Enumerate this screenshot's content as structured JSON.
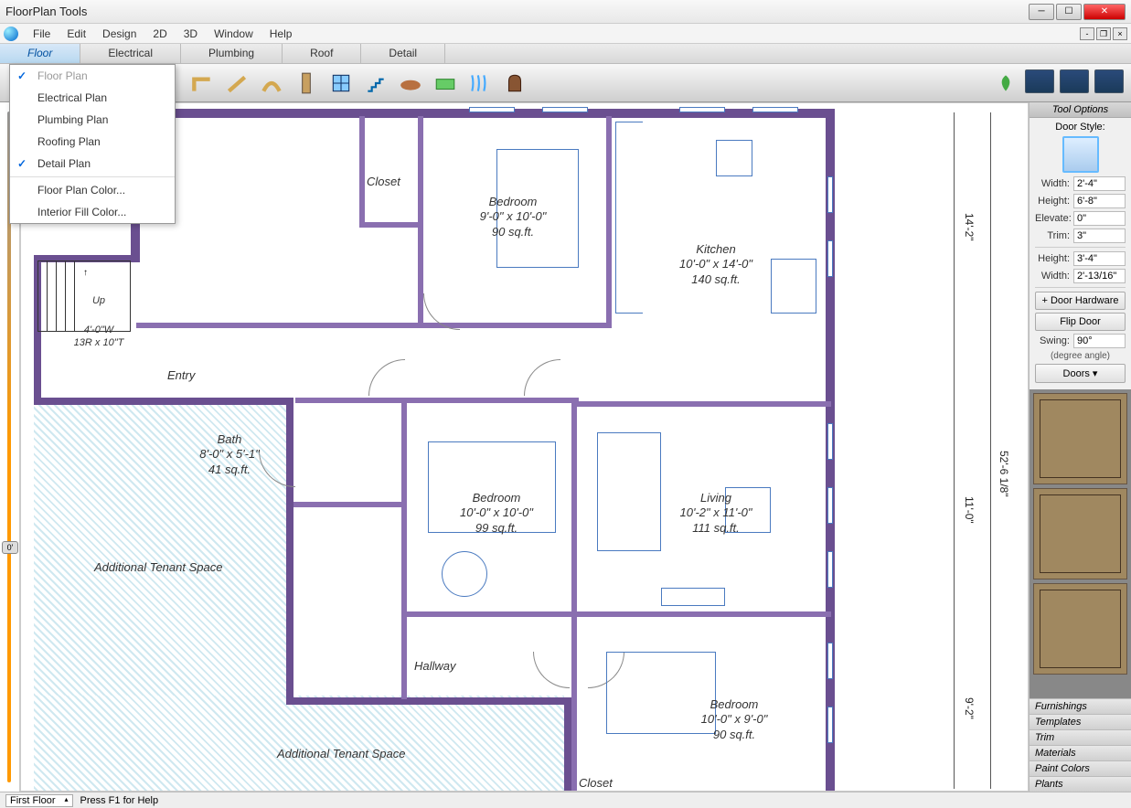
{
  "window": {
    "title": "FloorPlan Tools"
  },
  "menubar": {
    "items": [
      "File",
      "Edit",
      "Design",
      "2D",
      "3D",
      "Window",
      "Help"
    ]
  },
  "tabs": {
    "items": [
      "Floor",
      "Electrical",
      "Plumbing",
      "Roof",
      "Detail"
    ],
    "active": 0
  },
  "dropdown": {
    "items": [
      {
        "label": "Floor Plan",
        "checked": true,
        "disabled": true
      },
      {
        "label": "Electrical Plan"
      },
      {
        "label": "Plumbing Plan"
      },
      {
        "label": "Roofing Plan"
      },
      {
        "label": "Detail Plan",
        "checked": true
      },
      {
        "sep": true
      },
      {
        "label": "Floor Plan Color..."
      },
      {
        "label": "Interior Fill Color..."
      }
    ]
  },
  "slider": {
    "value": "0'"
  },
  "rooms": {
    "closet": {
      "name": "Closet"
    },
    "bedroom1": {
      "name": "Bedroom",
      "dims": "9'-0\" x 10'-0\"",
      "area": "90 sq.ft."
    },
    "kitchen": {
      "name": "Kitchen",
      "dims": "10'-0\" x 14'-0\"",
      "area": "140 sq.ft."
    },
    "entry": {
      "name": "Entry"
    },
    "bath": {
      "name": "Bath",
      "dims": "8'-0\" x 5'-1\"",
      "area": "41 sq.ft."
    },
    "bedroom2": {
      "name": "Bedroom",
      "dims": "10'-0\" x 10'-0\"",
      "area": "99 sq.ft."
    },
    "living": {
      "name": "Living",
      "dims": "10'-2\" x 11'-0\"",
      "area": "111 sq.ft."
    },
    "hallway": {
      "name": "Hallway"
    },
    "bedroom3": {
      "name": "Bedroom",
      "dims": "10'-0\" x 9'-0\"",
      "area": "90 sq.ft."
    },
    "closet2": {
      "name": "Closet"
    },
    "tenant1": {
      "name": "Additional Tenant Space"
    },
    "tenant2": {
      "name": "Additional Tenant Space"
    },
    "stairs": {
      "label": "Up",
      "dims": "4'-0\"W\n13R x 10\"T"
    }
  },
  "overall_dims": {
    "right1": "14'-2\"",
    "right2": "11'-0\"",
    "right3": "9'-2\"",
    "far_right": "52'-6 1/8\""
  },
  "tool_options": {
    "header": "Tool Options",
    "door_style_label": "Door Style:",
    "width_label": "Width:",
    "width_val": "2'-4\"",
    "height_label": "Height:",
    "height_val": "6'-8\"",
    "elevate_label": "Elevate:",
    "elevate_val": "0\"",
    "trim_label": "Trim:",
    "trim_val": "3\"",
    "height2_label": "Height:",
    "height2_val": "3'-4\"",
    "width2_label": "Width:",
    "width2_val": "2'-13/16\"",
    "hardware_btn": "Door Hardware",
    "flip_btn": "Flip Door",
    "swing_label": "Swing:",
    "swing_val": "90°",
    "swing_note": "(degree angle)",
    "doors_btn": "Doors ▾"
  },
  "categories": [
    "Furnishings",
    "Templates",
    "Trim",
    "Materials",
    "Paint Colors",
    "Plants"
  ],
  "statusbar": {
    "floor": "First Floor",
    "help": "Press F1 for Help"
  }
}
